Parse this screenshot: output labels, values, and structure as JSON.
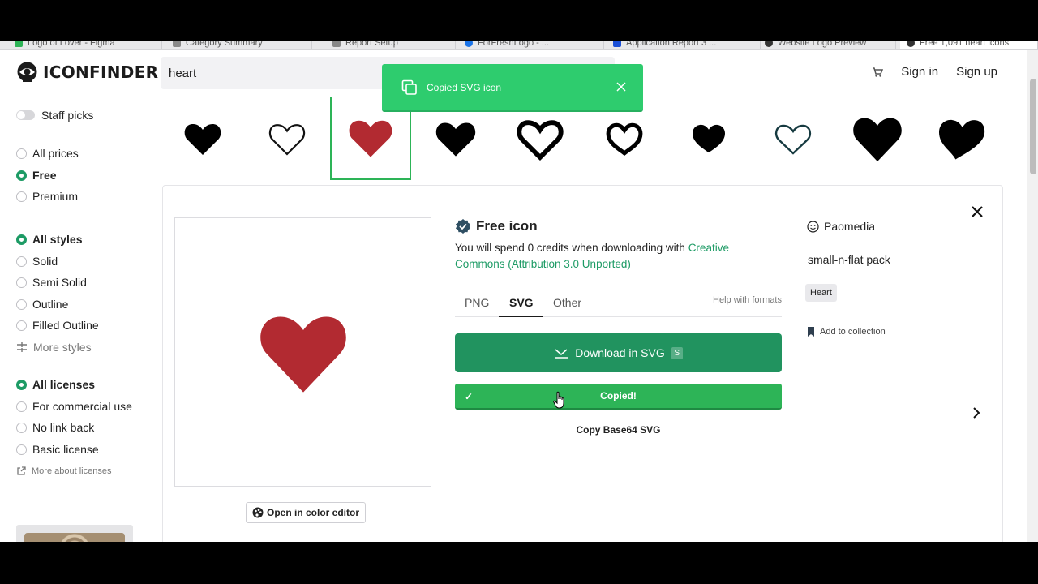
{
  "browser": {
    "tabs": [
      {
        "label": "Logo of Lover - Figma"
      },
      {
        "label": "Category Summary"
      },
      {
        "label": "Report Setup"
      },
      {
        "label": "ForFreshLogo - ..."
      },
      {
        "label": "Application Report 3 ..."
      },
      {
        "label": "Website Logo Preview"
      },
      {
        "label": "Free 1,091 heart icons"
      }
    ]
  },
  "header": {
    "logo_text": "ICONFINDER",
    "search_value": "heart",
    "sign_in": "Sign in",
    "sign_up": "Sign up"
  },
  "toast": {
    "message": "Copied SVG icon",
    "bg_color": "#2ecc6e"
  },
  "sidebar": {
    "staff_picks": "Staff picks",
    "prices": [
      {
        "label": "All prices",
        "selected": false
      },
      {
        "label": "Free",
        "selected": true
      },
      {
        "label": "Premium",
        "selected": false
      }
    ],
    "styles": [
      {
        "label": "All styles",
        "selected": true
      },
      {
        "label": "Solid",
        "selected": false
      },
      {
        "label": "Semi Solid",
        "selected": false
      },
      {
        "label": "Outline",
        "selected": false
      },
      {
        "label": "Filled Outline",
        "selected": false
      }
    ],
    "more_styles": "More styles",
    "licenses": [
      {
        "label": "All licenses",
        "selected": true
      },
      {
        "label": "For commercial use",
        "selected": false
      },
      {
        "label": "No link back",
        "selected": false
      },
      {
        "label": "Basic license",
        "selected": false
      }
    ],
    "more_licenses": "More about licenses"
  },
  "icon_strip": [
    {
      "name": "heart-solid-black",
      "selected": false
    },
    {
      "name": "heart-outline-thin",
      "selected": false
    },
    {
      "name": "heart-flat-red",
      "selected": true
    },
    {
      "name": "heart-solid-black-2",
      "selected": false
    },
    {
      "name": "heart-outline-bold",
      "selected": false
    },
    {
      "name": "heart-outline-round",
      "selected": false
    },
    {
      "name": "heart-solid-small",
      "selected": false
    },
    {
      "name": "heart-outline-dark-teal",
      "selected": false
    },
    {
      "name": "heart-solid-large",
      "selected": false
    },
    {
      "name": "heart-solid-tilted",
      "selected": false
    }
  ],
  "detail": {
    "free_label": "Free icon",
    "credits_text": "You will spend 0 credits when downloading with ",
    "license_link": "Creative Commons (Attribution 3.0 Unported)",
    "format_tabs": [
      "PNG",
      "SVG",
      "Other"
    ],
    "active_format": "SVG",
    "help_formats": "Help with formats",
    "download_label": "Download in SVG",
    "download_shortcut": "S",
    "copied_label": "Copied!",
    "copy_base64": "Copy Base64 SVG",
    "open_color_editor": "Open in color editor",
    "author": "Paomedia",
    "pack": "small-n-flat pack",
    "tag": "Heart",
    "add_to_collection": "Add to collection",
    "heart_color": "#b22a31",
    "accent_color": "#21935f"
  }
}
